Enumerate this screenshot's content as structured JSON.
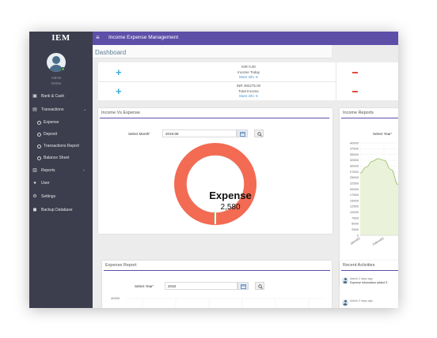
{
  "sidebar": {
    "logo": "IEM",
    "user_name": "Admin",
    "user_status": "Online",
    "items": [
      {
        "label": "Bank & Cash",
        "icon": "bank-icon"
      },
      {
        "label": "Transactions",
        "icon": "transactions-icon",
        "chevron": "⌄"
      },
      {
        "label": "Expense",
        "icon": "circle-icon"
      },
      {
        "label": "Deposit",
        "icon": "circle-icon"
      },
      {
        "label": "Transactions Report",
        "icon": "circle-icon"
      },
      {
        "label": "Balance Sheet",
        "icon": "circle-icon"
      },
      {
        "label": "Reports",
        "icon": "bar-chart-icon",
        "chevron": "›"
      },
      {
        "label": "User",
        "icon": "users-icon"
      },
      {
        "label": "Settings",
        "icon": "gear-icon"
      },
      {
        "label": "Backup Database",
        "icon": "database-icon"
      }
    ]
  },
  "topbar": {
    "menu_icon": "≡",
    "app_title": "Income Expense Management"
  },
  "page": {
    "title": "Dashboard"
  },
  "info": {
    "income_today_amount": "INR 0.00",
    "income_today_label": "Income Today",
    "total_income_amount": "INR 382275.00",
    "total_income_label": "Total Income",
    "more_info": "More info",
    "plus": "+"
  },
  "income_vs_expense": {
    "title": "Income Vs Expense",
    "select_label": "Select Month",
    "required": "*",
    "month_value": "2018-08",
    "donut_label": "Expense",
    "donut_value": "2,580",
    "color": "#f26b52"
  },
  "income_reports": {
    "title": "Income Reports",
    "select_label": "Select Year",
    "required": "*"
  },
  "expense_report": {
    "title": "Expense Report",
    "select_label": "Select Year",
    "required": "*",
    "year_value": "2018",
    "y_top_label": "40000"
  },
  "recent_activities": {
    "title": "Recent Activities",
    "items": [
      {
        "meta": "Admin 2 days ago",
        "message": "Expense Information added S"
      },
      {
        "meta": "Admin 2 days ago",
        "message": ""
      }
    ]
  },
  "chart_data": {
    "type": "area",
    "title": "Income Reports",
    "categories": [
      "January",
      "February",
      "March"
    ],
    "x_tick_labels": [
      "January",
      "February",
      "Marc"
    ],
    "y_ticks": [
      0,
      2500,
      5000,
      7500,
      10000,
      12500,
      15000,
      17500,
      20000,
      22500,
      25000,
      27500,
      30000,
      32500,
      35000,
      37500,
      40000
    ],
    "ylim": [
      0,
      40000
    ],
    "curve": [
      {
        "x": 0.0,
        "y": 27000
      },
      {
        "x": 0.25,
        "y": 29500
      },
      {
        "x": 0.5,
        "y": 32000
      },
      {
        "x": 0.75,
        "y": 33200
      },
      {
        "x": 1.0,
        "y": 32500
      },
      {
        "x": 1.3,
        "y": 28500
      },
      {
        "x": 1.6,
        "y": 22000
      },
      {
        "x": 1.8,
        "y": 17000
      },
      {
        "x": 2.05,
        "y": 11000
      }
    ],
    "fill_color": "#eaf3d9",
    "line_color": "#9fbf72",
    "grid": true
  }
}
